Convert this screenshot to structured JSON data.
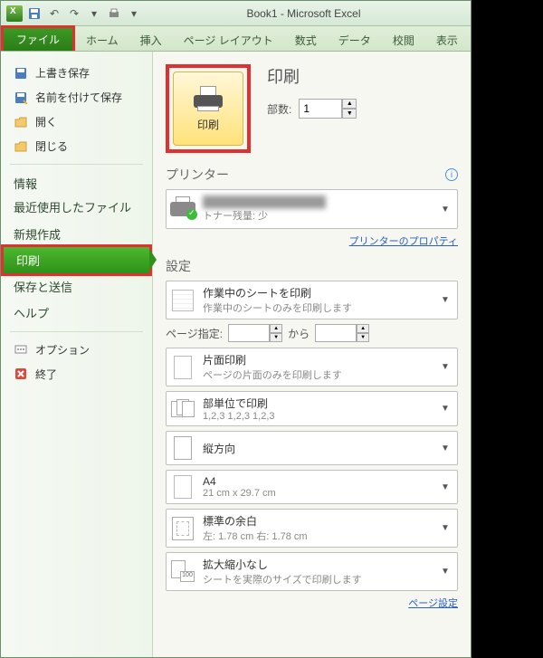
{
  "title": "Book1 - Microsoft Excel",
  "ribbon": {
    "file": "ファイル",
    "tabs": [
      "ホーム",
      "挿入",
      "ページ レイアウト",
      "数式",
      "データ",
      "校閲",
      "表示"
    ]
  },
  "sidebar": {
    "items": [
      {
        "label": "上書き保存",
        "icon": "save"
      },
      {
        "label": "名前を付けて保存",
        "icon": "save-as"
      },
      {
        "label": "開く",
        "icon": "open"
      },
      {
        "label": "閉じる",
        "icon": "close-doc"
      }
    ],
    "plain": [
      "情報",
      "最近使用したファイル",
      "新規作成"
    ],
    "active": "印刷",
    "plain2": [
      "保存と送信",
      "ヘルプ"
    ],
    "foot": [
      {
        "label": "オプション",
        "icon": "options"
      },
      {
        "label": "終了",
        "icon": "exit"
      }
    ]
  },
  "print": {
    "header": "印刷",
    "button_label": "印刷",
    "copies_label": "部数:",
    "copies_value": "1"
  },
  "printer": {
    "section": "プリンター",
    "status": "トナー残量: 少",
    "properties_link": "プリンターのプロパティ"
  },
  "settings": {
    "section": "設定",
    "print_what": {
      "t1": "作業中のシートを印刷",
      "t2": "作業中のシートのみを印刷します"
    },
    "page_label": "ページ指定:",
    "page_to": "から",
    "sides": {
      "t1": "片面印刷",
      "t2": "ページの片面のみを印刷します"
    },
    "collate": {
      "t1": "部単位で印刷",
      "t2": "1,2,3   1,2,3   1,2,3"
    },
    "orientation": {
      "t1": "縦方向",
      "t2": ""
    },
    "paper": {
      "t1": "A4",
      "t2": "21 cm x 29.7 cm"
    },
    "margins": {
      "t1": "標準の余白",
      "t2": "左: 1.78 cm   右: 1.78 cm"
    },
    "scaling": {
      "t1": "拡大縮小なし",
      "t2": "シートを実際のサイズで印刷します"
    },
    "page_setup_link": "ページ設定"
  }
}
